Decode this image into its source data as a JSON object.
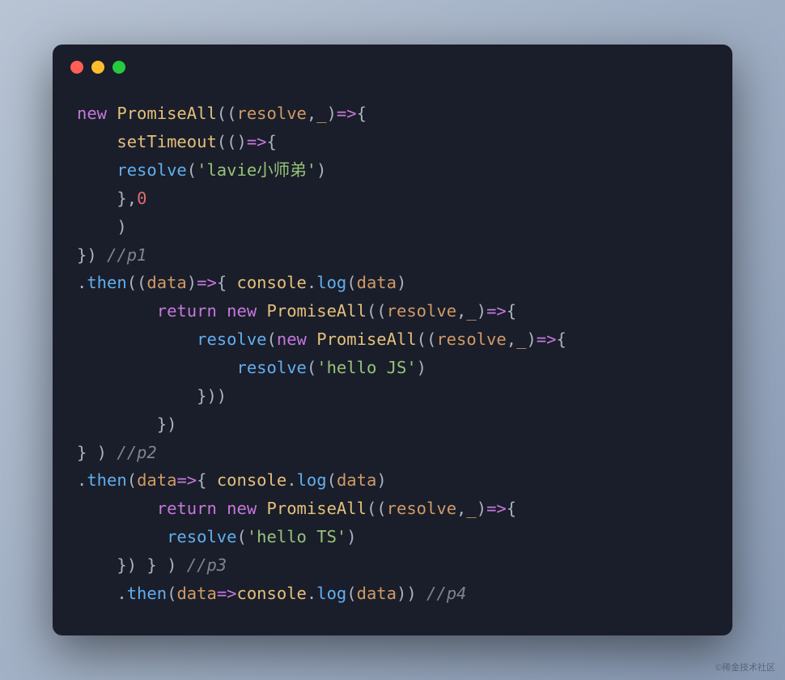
{
  "window": {
    "dots": [
      "red",
      "yellow",
      "green"
    ]
  },
  "code": {
    "l1": {
      "kw": "new",
      "cls": "PromiseAll",
      "p1": "((",
      "prm1": "resolve",
      "c": ",",
      "prm2": "_",
      "p2": ")",
      "ar": "=>",
      "p3": "{"
    },
    "l2": {
      "pad": "    ",
      "fn": "setTimeout",
      "p1": "(()",
      "ar": "=>",
      "p2": "{"
    },
    "l3": {
      "pad": "    ",
      "fn": "resolve",
      "p1": "(",
      "str": "'lavie小师弟'",
      "p2": ")"
    },
    "l4": {
      "pad": "    ",
      "p1": "},",
      "num": "0"
    },
    "l5": {
      "pad": "    ",
      "p": ")"
    },
    "l6": {
      "p": "}) ",
      "cmt": "//p1"
    },
    "l7": {
      "p1": ".",
      "fn": "then",
      "p2": "((",
      "prm": "data",
      "p3": ")",
      "ar": "=>",
      "p4": "{ ",
      "cls": "console",
      "p5": ".",
      "fn2": "log",
      "p6": "(",
      "prm2": "data",
      "p7": ")"
    },
    "l8": {
      "pad": "        ",
      "kw": "return",
      "sp": " ",
      "kw2": "new",
      "sp2": " ",
      "cls": "PromiseAll",
      "p1": "((",
      "prm1": "resolve",
      "c": ",",
      "prm2": "_",
      "p2": ")",
      "ar": "=>",
      "p3": "{"
    },
    "l9": {
      "pad": "            ",
      "fn": "resolve",
      "p1": "(",
      "kw": "new",
      "sp": " ",
      "cls": "PromiseAll",
      "p2": "((",
      "prm1": "resolve",
      "c": ",",
      "prm2": "_",
      "p3": ")",
      "ar": "=>",
      "p4": "{"
    },
    "l10": {
      "pad": "                ",
      "fn": "resolve",
      "p1": "(",
      "str": "'hello JS'",
      "p2": ")"
    },
    "l11": {
      "pad": "            ",
      "p": "}))"
    },
    "l12": {
      "pad": "        ",
      "p": "})"
    },
    "l13": {
      "p": "} ) ",
      "cmt": "//p2"
    },
    "l14": {
      "p1": ".",
      "fn": "then",
      "p2": "(",
      "prm": "data",
      "ar": "=>",
      "p3": "{ ",
      "cls": "console",
      "p4": ".",
      "fn2": "log",
      "p5": "(",
      "prm2": "data",
      "p6": ")"
    },
    "l15": {
      "pad": "        ",
      "kw": "return",
      "sp": " ",
      "kw2": "new",
      "sp2": " ",
      "cls": "PromiseAll",
      "p1": "((",
      "prm1": "resolve",
      "c": ",",
      "prm2": "_",
      "p2": ")",
      "ar": "=>",
      "p3": "{"
    },
    "l16": {
      "pad": "         ",
      "fn": "resolve",
      "p1": "(",
      "str": "'hello TS'",
      "p2": ")"
    },
    "l17": {
      "pad": "    ",
      "p": "}) } ) ",
      "cmt": "//p3"
    },
    "l18": {
      "pad": "    ",
      "p1": ".",
      "fn": "then",
      "p2": "(",
      "prm": "data",
      "ar": "=>",
      "cls": "console",
      "p3": ".",
      "fn2": "log",
      "p4": "(",
      "prm2": "data",
      "p5": ")) ",
      "cmt": "//p4"
    }
  },
  "watermark": "©稀金技术社区"
}
